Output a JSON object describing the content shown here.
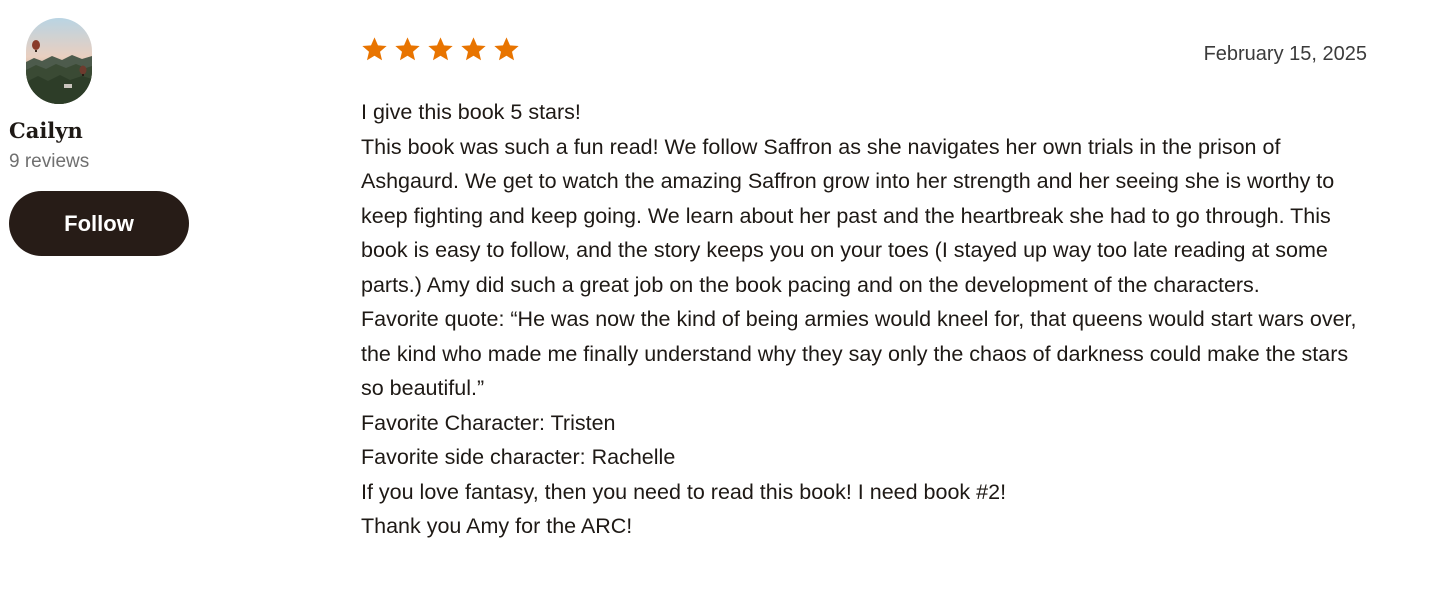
{
  "reviewer": {
    "name": "Cailyn",
    "review_count": "9 reviews",
    "follow_label": "Follow",
    "avatar_icon": "landscape-hot-air-balloons-photo"
  },
  "review": {
    "rating": 5,
    "rating_max": 5,
    "star_color": "#e87400",
    "date": "February 15, 2025",
    "paragraphs": [
      "I give this book 5 stars!",
      "This book was such a fun read! We follow Saffron as she navigates her own trials in the prison of Ashgaurd. We get to watch the amazing Saffron grow into her strength and her seeing she is worthy to keep fighting and keep going. We learn about her past and the heartbreak she had to go through. This book is easy to follow, and the story keeps you on your toes (I stayed up way too late reading at some parts.) Amy did such a great job on the book pacing and on the development of the characters.",
      "Favorite quote: “He was now the kind of being armies would kneel for, that queens would start wars over, the kind who made me finally understand why they say only the chaos of darkness could make the stars so beautiful.”",
      "Favorite Character: Tristen",
      "Favorite side character: Rachelle",
      "If you love fantasy, then you need to read this book! I need book #2!",
      "Thank you Amy for the ARC!"
    ]
  },
  "colors": {
    "follow_button_bg": "#271c17",
    "text": "#1e1915",
    "muted_text": "#707070"
  }
}
